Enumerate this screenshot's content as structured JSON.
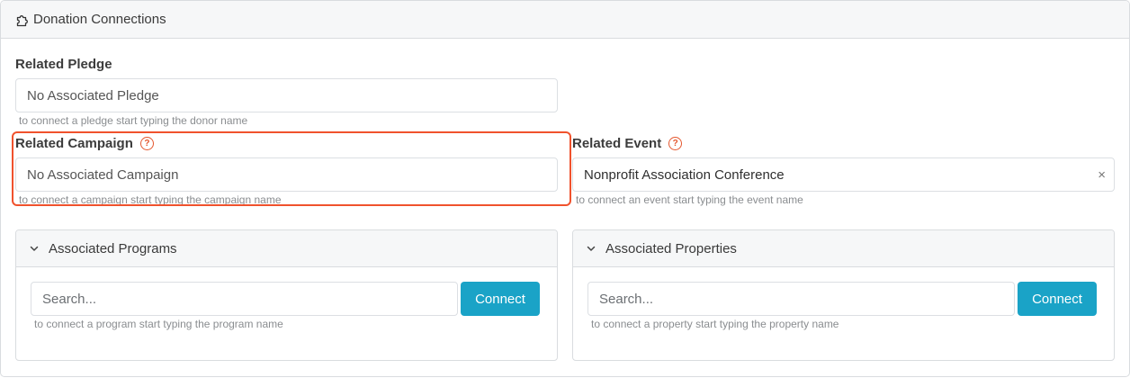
{
  "header": {
    "title": "Donation Connections",
    "icon": "puzzle-icon"
  },
  "pledge": {
    "label": "Related Pledge",
    "value": "No Associated Pledge",
    "hint": "to connect a pledge start typing the donor name"
  },
  "campaign": {
    "label": "Related Campaign",
    "help": "?",
    "value": "No Associated Campaign",
    "hint": "to connect a campaign start typing the campaign name"
  },
  "event": {
    "label": "Related Event",
    "help": "?",
    "value": "Nonprofit Association Conference",
    "clear": "×",
    "hint": "to connect an event start typing the event name"
  },
  "programs": {
    "title": "Associated Programs",
    "placeholder": "Search...",
    "button": "Connect",
    "hint": "to connect a program start typing the program name"
  },
  "properties": {
    "title": "Associated Properties",
    "placeholder": "Search...",
    "button": "Connect",
    "hint": "to connect a property start typing the property name"
  },
  "colors": {
    "accent": "#1aa3c7",
    "highlight": "#f0522d",
    "help": "#e4572e"
  }
}
